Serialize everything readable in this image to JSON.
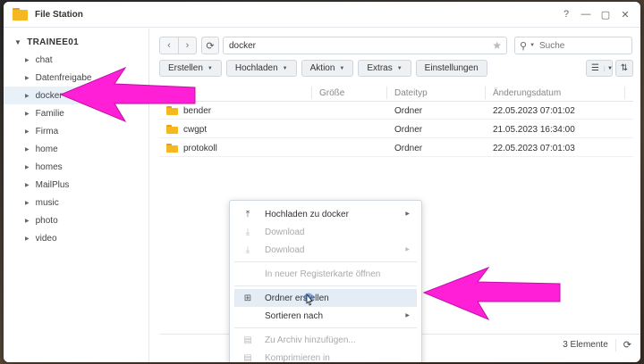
{
  "window": {
    "title": "File Station",
    "controls": {
      "help": "?",
      "minimize": "—",
      "maximize": "▢",
      "close": "✕"
    }
  },
  "sidebar": {
    "root_label": "TRAINEE01",
    "items": [
      {
        "label": "chat"
      },
      {
        "label": "Datenfreigabe"
      },
      {
        "label": "docker"
      },
      {
        "label": "Familie"
      },
      {
        "label": "Firma"
      },
      {
        "label": "home"
      },
      {
        "label": "homes"
      },
      {
        "label": "MailPlus"
      },
      {
        "label": "music"
      },
      {
        "label": "photo"
      },
      {
        "label": "video"
      }
    ],
    "selected_index": 2
  },
  "toolbar": {
    "path": "docker",
    "search_placeholder": "Suche",
    "actions": [
      {
        "label": "Erstellen",
        "dropdown": true
      },
      {
        "label": "Hochladen",
        "dropdown": true
      },
      {
        "label": "Aktion",
        "dropdown": true
      },
      {
        "label": "Extras",
        "dropdown": true
      },
      {
        "label": "Einstellungen",
        "dropdown": false
      }
    ]
  },
  "table": {
    "columns": [
      "Größe",
      "Dateityp",
      "Änderungsdatum"
    ],
    "rows": [
      {
        "name": "bender",
        "size": "",
        "type": "Ordner",
        "date": "22.05.2023 07:01:02"
      },
      {
        "name": "cwgpt",
        "size": "",
        "type": "Ordner",
        "date": "21.05.2023 16:34:00"
      },
      {
        "name": "protokoll",
        "size": "",
        "type": "Ordner",
        "date": "22.05.2023 07:01:03"
      }
    ]
  },
  "status": {
    "count": "3 Elemente"
  },
  "context_menu": {
    "items": [
      {
        "label": "Hochladen zu docker",
        "icon": "upload-icon",
        "disabled": false,
        "submenu": true
      },
      {
        "label": "Download",
        "icon": "download-icon",
        "disabled": true,
        "submenu": false
      },
      {
        "label": "Download",
        "icon": "download-icon",
        "disabled": true,
        "submenu": true
      },
      {
        "separator": true
      },
      {
        "label": "In neuer Registerkarte öffnen",
        "icon": "",
        "disabled": true,
        "submenu": false
      },
      {
        "separator": true
      },
      {
        "label": "Ordner erstellen",
        "icon": "new-folder-icon",
        "disabled": false,
        "submenu": false,
        "hover": true
      },
      {
        "label": "Sortieren nach",
        "icon": "",
        "disabled": false,
        "submenu": true
      },
      {
        "separator": true
      },
      {
        "label": "Zu Archiv hinzufügen...",
        "icon": "archive-icon",
        "disabled": true,
        "submenu": false
      },
      {
        "label": "Komprimieren in",
        "icon": "archive-icon",
        "disabled": true,
        "submenu": false
      }
    ]
  },
  "colors": {
    "annotation_arrow": "#ff1fd6",
    "folder": "#f5b821",
    "selection": "#e8f0f8"
  }
}
